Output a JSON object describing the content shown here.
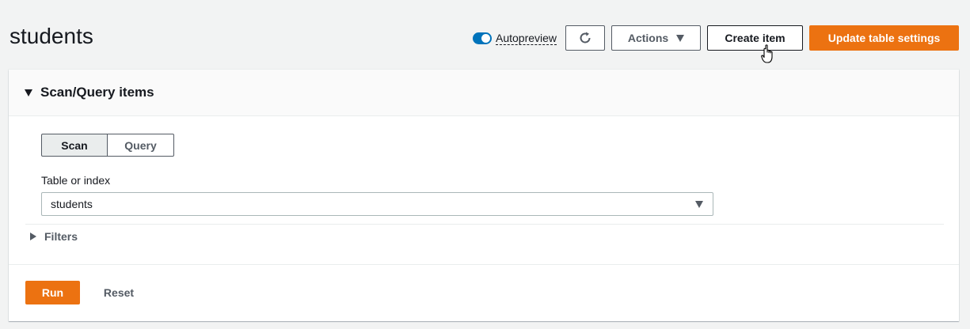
{
  "header": {
    "title": "students",
    "autopreview_label": "Autopreview",
    "autopreview_on": true,
    "actions_label": "Actions",
    "create_item_label": "Create item",
    "update_settings_label": "Update table settings"
  },
  "panel": {
    "title": "Scan/Query items",
    "expanded": true,
    "modes": [
      {
        "label": "Scan",
        "selected": true
      },
      {
        "label": "Query",
        "selected": false
      }
    ],
    "table_or_index_label": "Table or index",
    "table_or_index_value": "students",
    "filters_label": "Filters",
    "run_label": "Run",
    "reset_label": "Reset"
  },
  "colors": {
    "accent": "#ec7211",
    "toggle": "#0073bb",
    "background": "#f2f3f3"
  },
  "icons": [
    "refresh-icon",
    "caret-down-icon",
    "pointer-hand-icon",
    "expand-triangle-icon",
    "collapse-triangle-icon"
  ]
}
